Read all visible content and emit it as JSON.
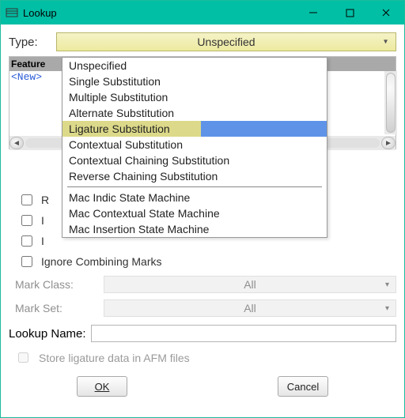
{
  "window": {
    "title": "Lookup"
  },
  "type": {
    "label": "Type:",
    "selected": "Unspecified",
    "options": [
      "Unspecified",
      "Single Substitution",
      "Multiple Substitution",
      "Alternate Substitution",
      "Ligature Substitution",
      "Contextual Substitution",
      "Contextual Chaining Substitution",
      "Reverse Chaining Substitution"
    ],
    "mac_options": [
      "Mac Indic State Machine",
      "Mac Contextual State Machine",
      "Mac Insertion State Machine"
    ],
    "highlighted": "Ligature Substitution"
  },
  "features": {
    "header": "Feature",
    "new_entry": "<New>"
  },
  "checks": {
    "right_to_left": "R",
    "ignore_base": "I",
    "ignore_lig": "I",
    "ignore_marks": "Ignore Combining Marks"
  },
  "mark_class": {
    "label": "Mark Class:",
    "value": "All"
  },
  "mark_set": {
    "label": "Mark Set:",
    "value": "All"
  },
  "lookup_name": {
    "label": "Lookup Name:",
    "value": ""
  },
  "afm": {
    "label": "Store ligature data in AFM files"
  },
  "buttons": {
    "ok": "OK",
    "cancel": "Cancel"
  }
}
